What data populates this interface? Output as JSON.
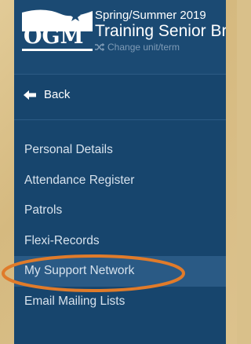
{
  "header": {
    "logo_text": "OGM",
    "term": "Spring/Summer 2019",
    "unit_name": "Training Senior Br",
    "change_link": "Change unit/term"
  },
  "nav": {
    "back_label": "Back"
  },
  "menu": {
    "items": [
      {
        "label": "Personal Details"
      },
      {
        "label": "Attendance Register"
      },
      {
        "label": "Patrols"
      },
      {
        "label": "Flexi-Records"
      },
      {
        "label": "My Support Network"
      },
      {
        "label": "Email Mailing Lists"
      }
    ],
    "active_index": 4
  },
  "colors": {
    "panel": "#17456d",
    "highlight_ring": "#e07b2a",
    "background": "#d9c08a"
  }
}
